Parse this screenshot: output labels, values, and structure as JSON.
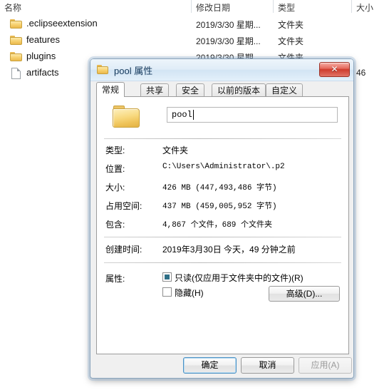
{
  "explorer": {
    "columns": [
      {
        "key": "name",
        "label": "名称"
      },
      {
        "key": "date",
        "label": "修改日期"
      },
      {
        "key": "type",
        "label": "类型"
      },
      {
        "key": "size",
        "label": "大小"
      }
    ],
    "rows": [
      {
        "name": ".eclipseextension",
        "date": "2019/3/30 星期...",
        "type": "文件夹",
        "size": "",
        "icon": "folder-icon"
      },
      {
        "name": "features",
        "date": "2019/3/30 星期...",
        "type": "文件夹",
        "size": "",
        "icon": "folder-icon"
      },
      {
        "name": "plugins",
        "date": "2019/3/30 星期...",
        "type": "文件夹",
        "size": "",
        "icon": "folder-icon"
      },
      {
        "name": "artifacts",
        "date": "",
        "type": "",
        "size": "46",
        "icon": "file-icon"
      }
    ]
  },
  "dialog": {
    "title": "pool 属性",
    "title_icon": "folder-icon",
    "close_label": "✕",
    "tabs": [
      {
        "label": "常规",
        "active": true
      },
      {
        "label": "共享",
        "active": false
      },
      {
        "label": "安全",
        "active": false
      },
      {
        "label": "以前的版本",
        "active": false
      },
      {
        "label": "自定义",
        "active": false
      }
    ],
    "name_field": {
      "value": "pool",
      "placeholder": ""
    },
    "properties": [
      {
        "label": "类型:",
        "value": "文件夹",
        "mono": false
      },
      {
        "label": "位置:",
        "value": "C:\\Users\\Administrator\\.p2",
        "mono": true
      },
      {
        "label": "大小:",
        "value": "426 MB (447,493,486 字节)",
        "mono": true
      },
      {
        "label": "占用空间:",
        "value": "437 MB (459,005,952 字节)",
        "mono": true
      },
      {
        "label": "包含:",
        "value": "4,867 个文件，689 个文件夹",
        "mono": true
      }
    ],
    "created": {
      "label": "创建时间:",
      "value": "2019年3月30日 今天，49 分钟之前"
    },
    "attributes": {
      "label": "属性:",
      "readonly": {
        "label": "只读(仅应用于文件夹中的文件)(R)",
        "state": "mixed"
      },
      "hidden": {
        "label": "隐藏(H)",
        "state": "unchecked"
      },
      "advanced_label": "高级(D)..."
    },
    "buttons": {
      "ok": "确定",
      "cancel": "取消",
      "apply": "应用(A)"
    }
  },
  "colors": {
    "accent": "#2f6f86",
    "close_red": "#cf3b2d",
    "title_text": "#14395c",
    "folder_yellow": "#eec257"
  }
}
